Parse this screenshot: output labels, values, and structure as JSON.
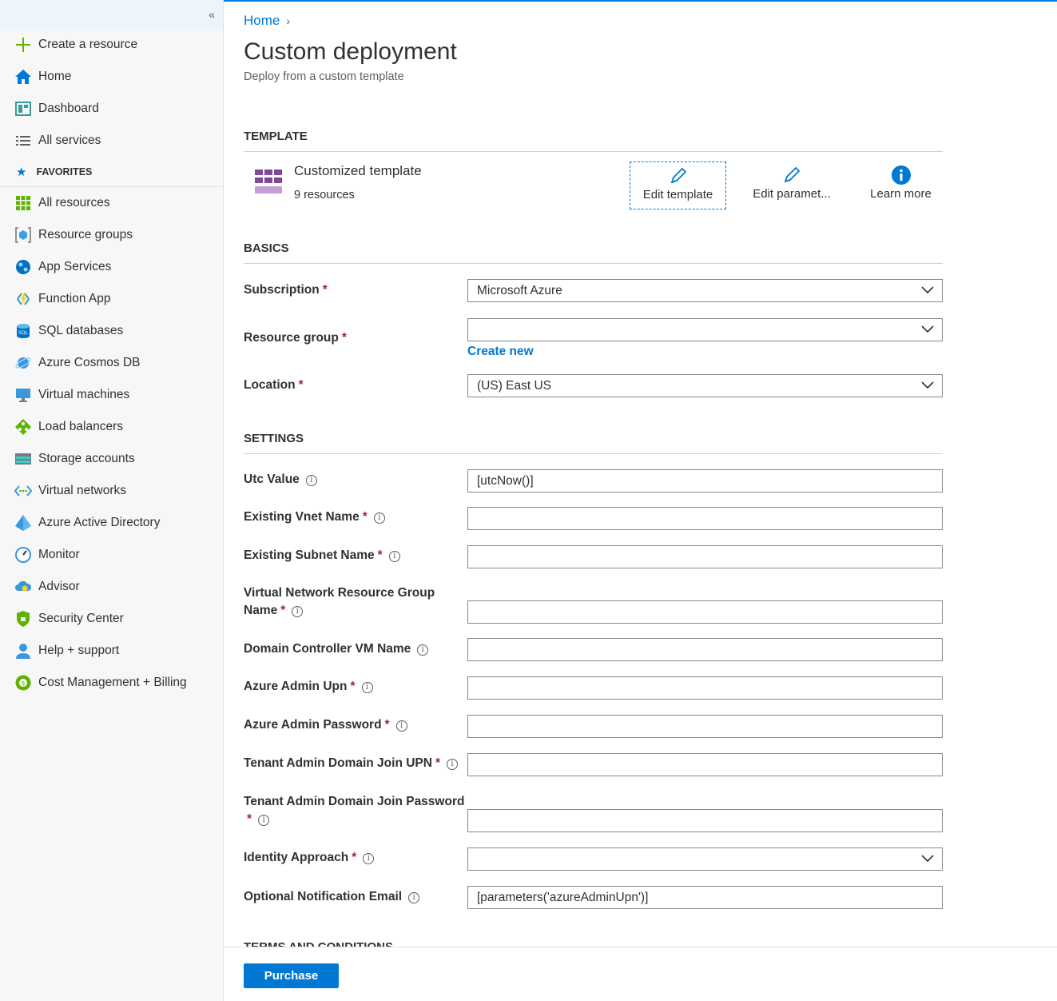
{
  "sidebar": {
    "collapse_glyph": "«",
    "top_items": [
      {
        "label": "Create a resource",
        "icon": "plus-icon"
      },
      {
        "label": "Home",
        "icon": "home-icon"
      },
      {
        "label": "Dashboard",
        "icon": "dashboard-icon"
      },
      {
        "label": "All services",
        "icon": "list-icon"
      }
    ],
    "favorites_label": "FAVORITES",
    "favorites": [
      {
        "label": "All resources",
        "icon": "grid-icon"
      },
      {
        "label": "Resource groups",
        "icon": "resource-group-icon"
      },
      {
        "label": "App Services",
        "icon": "globe-icon"
      },
      {
        "label": "Function App",
        "icon": "lightning-icon"
      },
      {
        "label": "SQL databases",
        "icon": "sql-icon"
      },
      {
        "label": "Azure Cosmos DB",
        "icon": "planet-icon"
      },
      {
        "label": "Virtual machines",
        "icon": "monitor-icon"
      },
      {
        "label": "Load balancers",
        "icon": "diamond-icon"
      },
      {
        "label": "Storage accounts",
        "icon": "storage-icon"
      },
      {
        "label": "Virtual networks",
        "icon": "network-icon"
      },
      {
        "label": "Azure Active Directory",
        "icon": "pyramid-icon"
      },
      {
        "label": "Monitor",
        "icon": "gauge-icon"
      },
      {
        "label": "Advisor",
        "icon": "cloud-icon"
      },
      {
        "label": "Security Center",
        "icon": "shield-icon"
      },
      {
        "label": "Help + support",
        "icon": "person-icon"
      },
      {
        "label": "Cost Management + Billing",
        "icon": "coin-icon"
      }
    ]
  },
  "breadcrumb": {
    "home": "Home",
    "chevron": "›"
  },
  "page": {
    "title": "Custom deployment",
    "subtitle": "Deploy from a custom template"
  },
  "template": {
    "header": "TEMPLATE",
    "name": "Customized template",
    "resources": "9 resources",
    "edit_template": "Edit template",
    "edit_parameters": "Edit paramet...",
    "learn_more": "Learn more"
  },
  "basics": {
    "header": "BASICS",
    "subscription_label": "Subscription",
    "subscription_value": "Microsoft Azure",
    "resource_group_label": "Resource group",
    "resource_group_value": "",
    "create_new": "Create new",
    "location_label": "Location",
    "location_value": "(US) East US"
  },
  "settings": {
    "header": "SETTINGS",
    "utc_label": "Utc Value",
    "utc_value": "[utcNow()]",
    "vnet_label": "Existing Vnet Name",
    "subnet_label": "Existing Subnet Name",
    "vnet_rg_label_1": "Virtual Network Resource Group",
    "vnet_rg_label_2": "Name",
    "dc_label": "Domain Controller VM Name",
    "admin_upn_label": "Azure Admin Upn",
    "admin_pw_label": "Azure Admin Password",
    "tenant_upn_label": "Tenant Admin Domain Join UPN",
    "tenant_pw_label": "Tenant Admin Domain Join Password",
    "identity_label": "Identity Approach",
    "identity_value": "",
    "email_label": "Optional Notification Email",
    "email_value": "[parameters('azureAdminUpn')]"
  },
  "terms_header": "TERMS AND CONDITIONS",
  "required_mark": "*",
  "info_glyph": "i",
  "footer": {
    "purchase": "Purchase"
  },
  "colors": {
    "accent": "#0078d4",
    "required": "#a4262c"
  }
}
